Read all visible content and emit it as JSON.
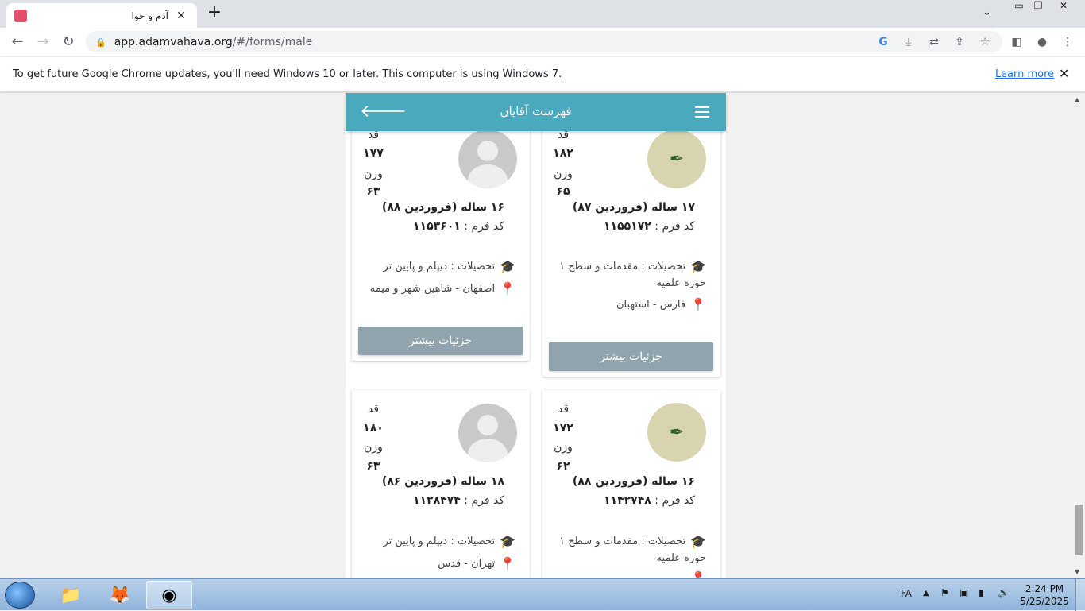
{
  "browser": {
    "tab_title": "آدم و حوا",
    "url_host": "app.adamvahava.org",
    "url_path": "/#/forms/male",
    "infobar_message": "To get future Google Chrome updates, you'll need Windows 10 or later. This computer is using Windows 7.",
    "infobar_link": "Learn more"
  },
  "app": {
    "title": "فهرست آقایان",
    "accent_color": "#4aa9bd",
    "button_color": "#91a4ae"
  },
  "labels": {
    "height": "قد",
    "weight": "وزن",
    "form_code": "کد فرم :",
    "education": "تحصیلات :",
    "details_button": "جزئیات بیشتر"
  },
  "cards": [
    {
      "height": "۱۸۲",
      "weight": "۶۵",
      "age": "۱۷ ساله (فروردین ۸۷)",
      "code": "۱۱۵۵۱۷۲",
      "education": "مقدمات و سطح ۱ حوزه علمیه",
      "location": "فارس - استهبان",
      "avatar": "logo"
    },
    {
      "height": "۱۷۷",
      "weight": "۶۳",
      "age": "۱۶ ساله (فروردین ۸۸)",
      "code": "۱۱۵۳۶۰۱",
      "education": "دیپلم و پایین تر",
      "location": "اصفهان - شاهین شهر و میمه",
      "avatar": "default"
    },
    {
      "height": "۱۷۲",
      "weight": "۶۲",
      "age": "۱۶ ساله (فروردین ۸۸)",
      "code": "۱۱۴۲۷۴۸",
      "education": "مقدمات و سطح ۱ حوزه علمیه",
      "location": "",
      "avatar": "logo"
    },
    {
      "height": "۱۸۰",
      "weight": "۶۳",
      "age": "۱۸ ساله (فروردین ۸۶)",
      "code": "۱۱۲۸۴۷۴",
      "education": "دیپلم و پایین تر",
      "location": "تهران - قدس",
      "avatar": "default"
    }
  ],
  "taskbar": {
    "language": "FA",
    "time": "2:24 PM",
    "date": "5/25/2025"
  }
}
